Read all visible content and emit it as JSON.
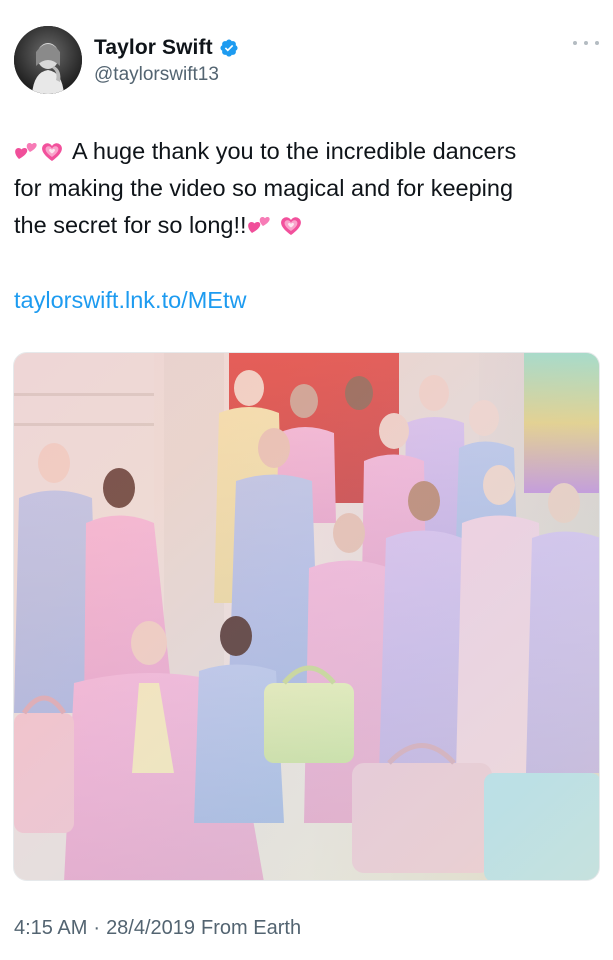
{
  "author": {
    "display_name": "Taylor Swift",
    "handle": "@taylorswift13",
    "verified": true,
    "avatar_icon": "profile-photo"
  },
  "tweet": {
    "line1_pre_emoji": [
      "two-hearts-emoji",
      "sparkling-heart-emoji"
    ],
    "line1": "A huge thank you to the incredible dancers",
    "line2": "for making the video so magical and for keeping",
    "line3": "the secret for so long!!",
    "line3_post_emoji": [
      "two-hearts-emoji",
      "sparkling-heart-emoji"
    ],
    "link": "taylorswift.lnk.to/MEtw"
  },
  "media": {
    "description_icon": "group-photo-image"
  },
  "meta": {
    "time": "4:15 AM",
    "separator": "·",
    "date": "28/4/2019",
    "source": "From Earth"
  },
  "colors": {
    "link": "#1d9bf0",
    "verified": "#1d9bf0",
    "secondary_text": "#536471",
    "primary_text": "#0f1419"
  }
}
